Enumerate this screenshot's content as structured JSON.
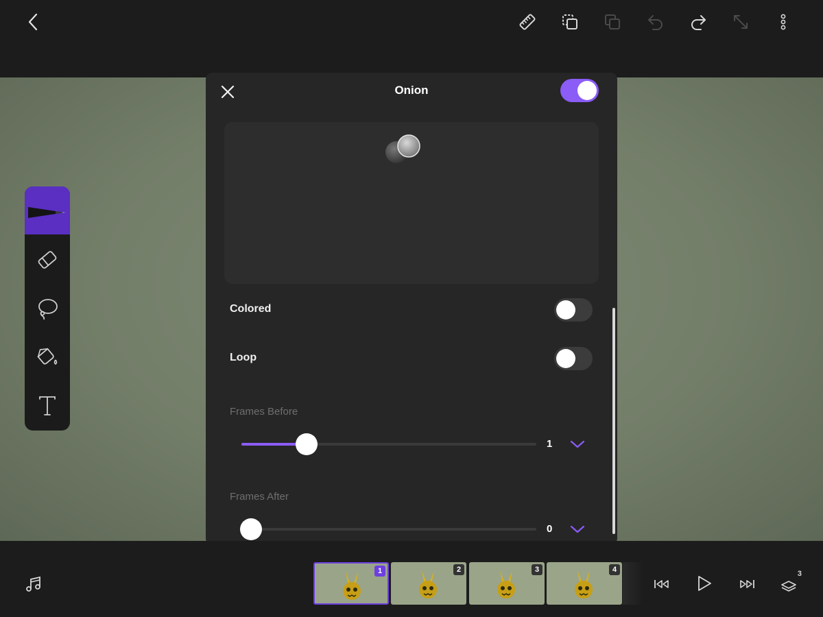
{
  "panel": {
    "title": "Onion",
    "enabled": true,
    "colored_label": "Colored",
    "colored_on": false,
    "loop_label": "Loop",
    "loop_on": false,
    "frames_before_label": "Frames Before",
    "frames_before_value": "1",
    "frames_before_fraction": 0.22,
    "frames_after_label": "Frames After",
    "frames_after_value": "0",
    "frames_after_fraction": 0.0
  },
  "timeline": {
    "frames": [
      {
        "number": "1",
        "active": true
      },
      {
        "number": "2",
        "active": false
      },
      {
        "number": "3",
        "active": false
      },
      {
        "number": "4",
        "active": false
      }
    ],
    "layer_count": "3"
  },
  "icons": {
    "top": [
      "back-icon",
      "ruler-icon",
      "copy-frame-icon",
      "paste-frame-icon",
      "undo-icon",
      "redo-icon",
      "resize-icon",
      "more-icon"
    ],
    "tools": [
      "pen-icon",
      "eraser-icon",
      "lasso-icon",
      "fill-bucket-icon",
      "text-tool-icon"
    ],
    "bottom": [
      "music-icon",
      "skip-to-start-icon",
      "play-icon",
      "skip-to-end-icon",
      "layers-icon"
    ]
  },
  "colors": {
    "accent": "#8b5cf6",
    "active_tool": "#5a2fc2",
    "canvas": "#7a8570",
    "panel_bg": "#262626"
  }
}
